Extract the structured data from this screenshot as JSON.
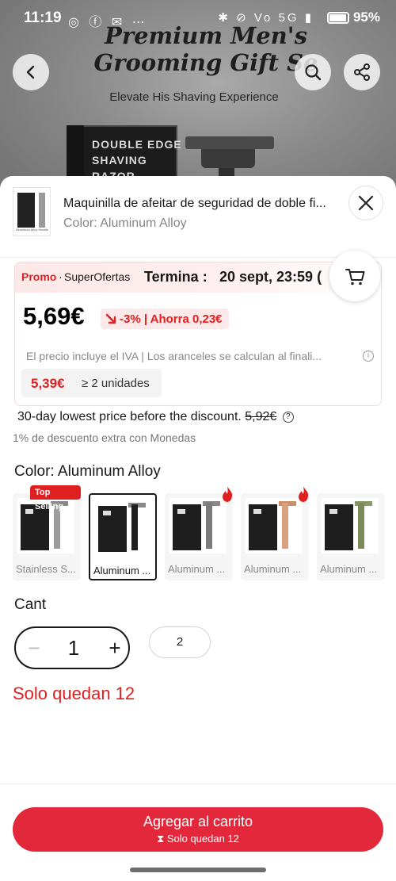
{
  "status_bar": {
    "time": "11:19",
    "left_icons": "◎ ⓕ ✉ ⋯",
    "right_icons": "✱ ⊘ Vo 5G ▮",
    "battery": "95%"
  },
  "hero": {
    "title": "Premium Men's Grooming Gift Se",
    "subtitle": "Elevate His Shaving Experience",
    "box_text": "DOUBLE EDGE SHAVING RAZOR"
  },
  "product": {
    "title": "Maquinilla de afeitar de seguridad de doble fi...",
    "selected_color_line": "Color: Aluminum Alloy",
    "thumb_caption": "Aluminum Alloy Handle · Razor Weight 58g"
  },
  "promo": {
    "label": "Promo",
    "separator": "·",
    "name": "SuperOfertas",
    "ends_label": "Termina :",
    "ends_date": "20 sept, 23:59 ("
  },
  "price": {
    "current": "5,69€",
    "discount": "-3% | Ahorra 0,23€",
    "tax_note": "El precio incluye el IVA | Los aranceles se calculan al finali...",
    "info_icon": "i",
    "tier_price": "5,39€",
    "tier_qty": "≥ 2 unidades",
    "lowest_price_text": "30-day lowest price before the discount.",
    "lowest_price_value": "5,92€",
    "help_icon": "?",
    "coins_note": "1% de descuento extra con Monedas"
  },
  "colors": {
    "title": "Color: Aluminum Alloy",
    "top_badge": "Top Selling",
    "items": [
      {
        "label": "Stainless S...",
        "caption": "Stainless Steel Handle · Razor Weight 102g",
        "handle": "#9c9c9c"
      },
      {
        "label": "Aluminum ...",
        "caption": "Aluminum Alloy Handle · Razor Weight 58g",
        "handle": "#1f1f1f"
      },
      {
        "label": "Aluminum ...",
        "caption": "Aluminum Alloy Handle · Razor Weight 58g",
        "handle": "#7a7a7a"
      },
      {
        "label": "Aluminum ...",
        "caption": "Aluminum Alloy Handle · Razor Weight 58g",
        "handle": "#d9a27f"
      },
      {
        "label": "Aluminum ...",
        "caption": "Aluminum Alloy Handle · Razor Weight 58g",
        "handle": "#7c8a5c"
      }
    ]
  },
  "quantity": {
    "title": "Cant",
    "minus": "−",
    "value": "1",
    "plus": "+",
    "quick_option": "2",
    "stock_left": "Solo quedan 12"
  },
  "cta": {
    "label": "Agregar al carrito",
    "sub": "⧗ Solo quedan 12"
  },
  "colors_palette": {
    "accent": "#e3283b",
    "promo_red": "#e02020"
  }
}
